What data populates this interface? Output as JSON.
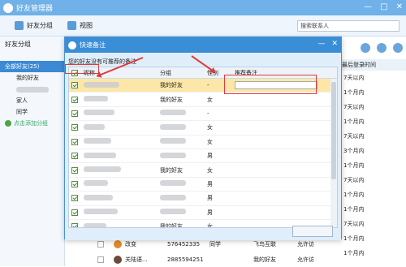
{
  "app": {
    "title": "好友管理器"
  },
  "toolbar": {
    "friend_group": "好友分组",
    "view": "视图",
    "search_placeholder": "搜索联系人"
  },
  "sidebar": {
    "header": "好友分组",
    "all": "全部好友(25)",
    "items": [
      "我的好友",
      "家人",
      "同学"
    ],
    "add_group": "点击添加分组"
  },
  "right_column": {
    "header": "最后登录时间",
    "rows": [
      "7天以内",
      "1个月内",
      "7天以内",
      "1个月内",
      "7天以内",
      "3个月内",
      "1个月内",
      "7天以内",
      "1个月内",
      "1个月内",
      "7天以内",
      "1个月内",
      "1个月内"
    ]
  },
  "dialog": {
    "title": "快速备注",
    "description": "您的好友没有可推荐的备注",
    "columns": {
      "nick": "昵称",
      "group": "分组",
      "sex": "性别",
      "remark": "推荐备注"
    },
    "rows": [
      {
        "group": "我的好友",
        "sex": "-"
      },
      {
        "group": "我的好友",
        "sex": "女"
      },
      {
        "group": "",
        "sex": "-"
      },
      {
        "group": "",
        "sex": "女"
      },
      {
        "group": "",
        "sex": "女"
      },
      {
        "group": "",
        "sex": "男"
      },
      {
        "group": "我的好友",
        "sex": "女"
      },
      {
        "group": "",
        "sex": "男"
      },
      {
        "group": "",
        "sex": "男"
      },
      {
        "group": "",
        "sex": "男"
      },
      {
        "group": "我的好友",
        "sex": "女"
      }
    ]
  },
  "bottom_rows": [
    {
      "name": "改变",
      "id": "576452335",
      "group": "同学",
      "extra": "飞鸟互联",
      "perm": "允许访"
    },
    {
      "name": "关陆语...",
      "id": "2885594251",
      "group": "",
      "extra": "我的好友",
      "perm": "允许访"
    }
  ]
}
